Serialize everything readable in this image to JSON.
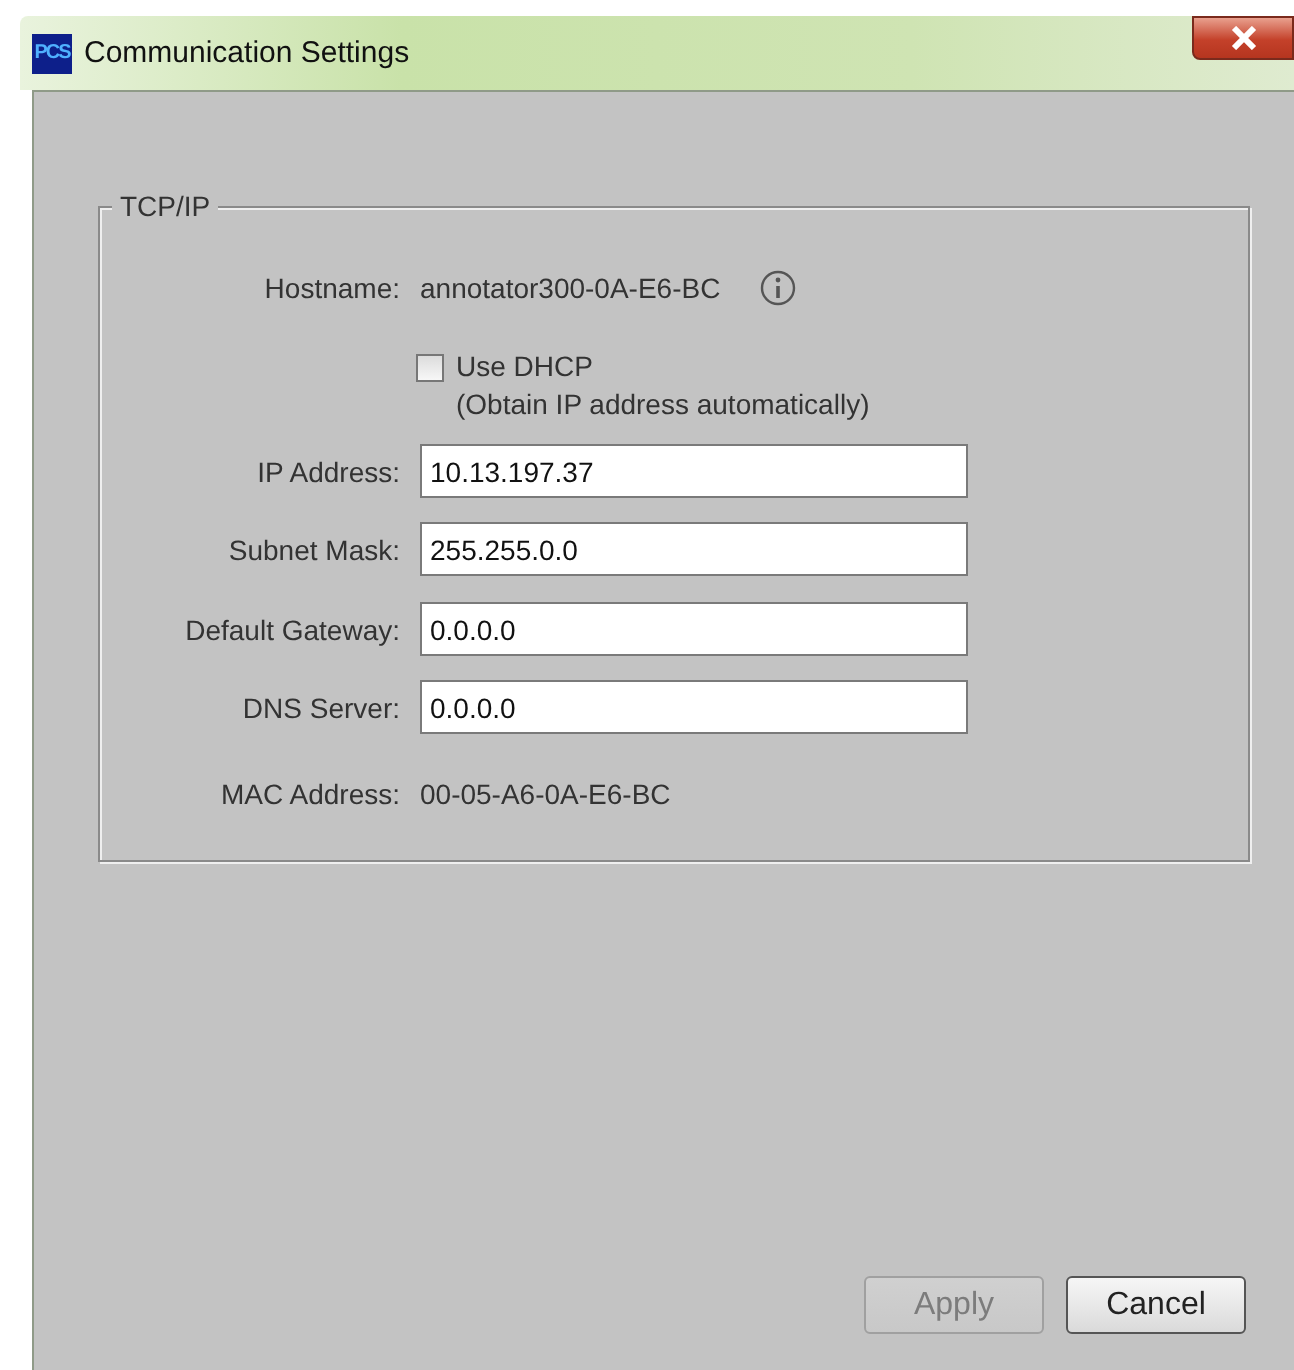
{
  "window": {
    "logo": "PCS",
    "title": "Communication Settings"
  },
  "group": {
    "title": "TCP/IP",
    "hostname": {
      "label": "Hostname:",
      "value": "annotator300-0A-E6-BC"
    },
    "dhcp": {
      "label": "Use DHCP",
      "note": "(Obtain IP address automatically)",
      "checked": false
    },
    "fields": [
      {
        "label": "IP Address:",
        "value": "10.13.197.37"
      },
      {
        "label": "Subnet Mask:",
        "value": "255.255.0.0"
      },
      {
        "label": "Default Gateway:",
        "value": "0.0.0.0"
      },
      {
        "label": "DNS Server:",
        "value": "0.0.0.0"
      }
    ],
    "mac": {
      "label": "MAC Address:",
      "value": "00-05-A6-0A-E6-BC"
    }
  },
  "buttons": [
    {
      "label": "Apply",
      "disabled": true
    },
    {
      "label": "Cancel",
      "disabled": false
    }
  ]
}
